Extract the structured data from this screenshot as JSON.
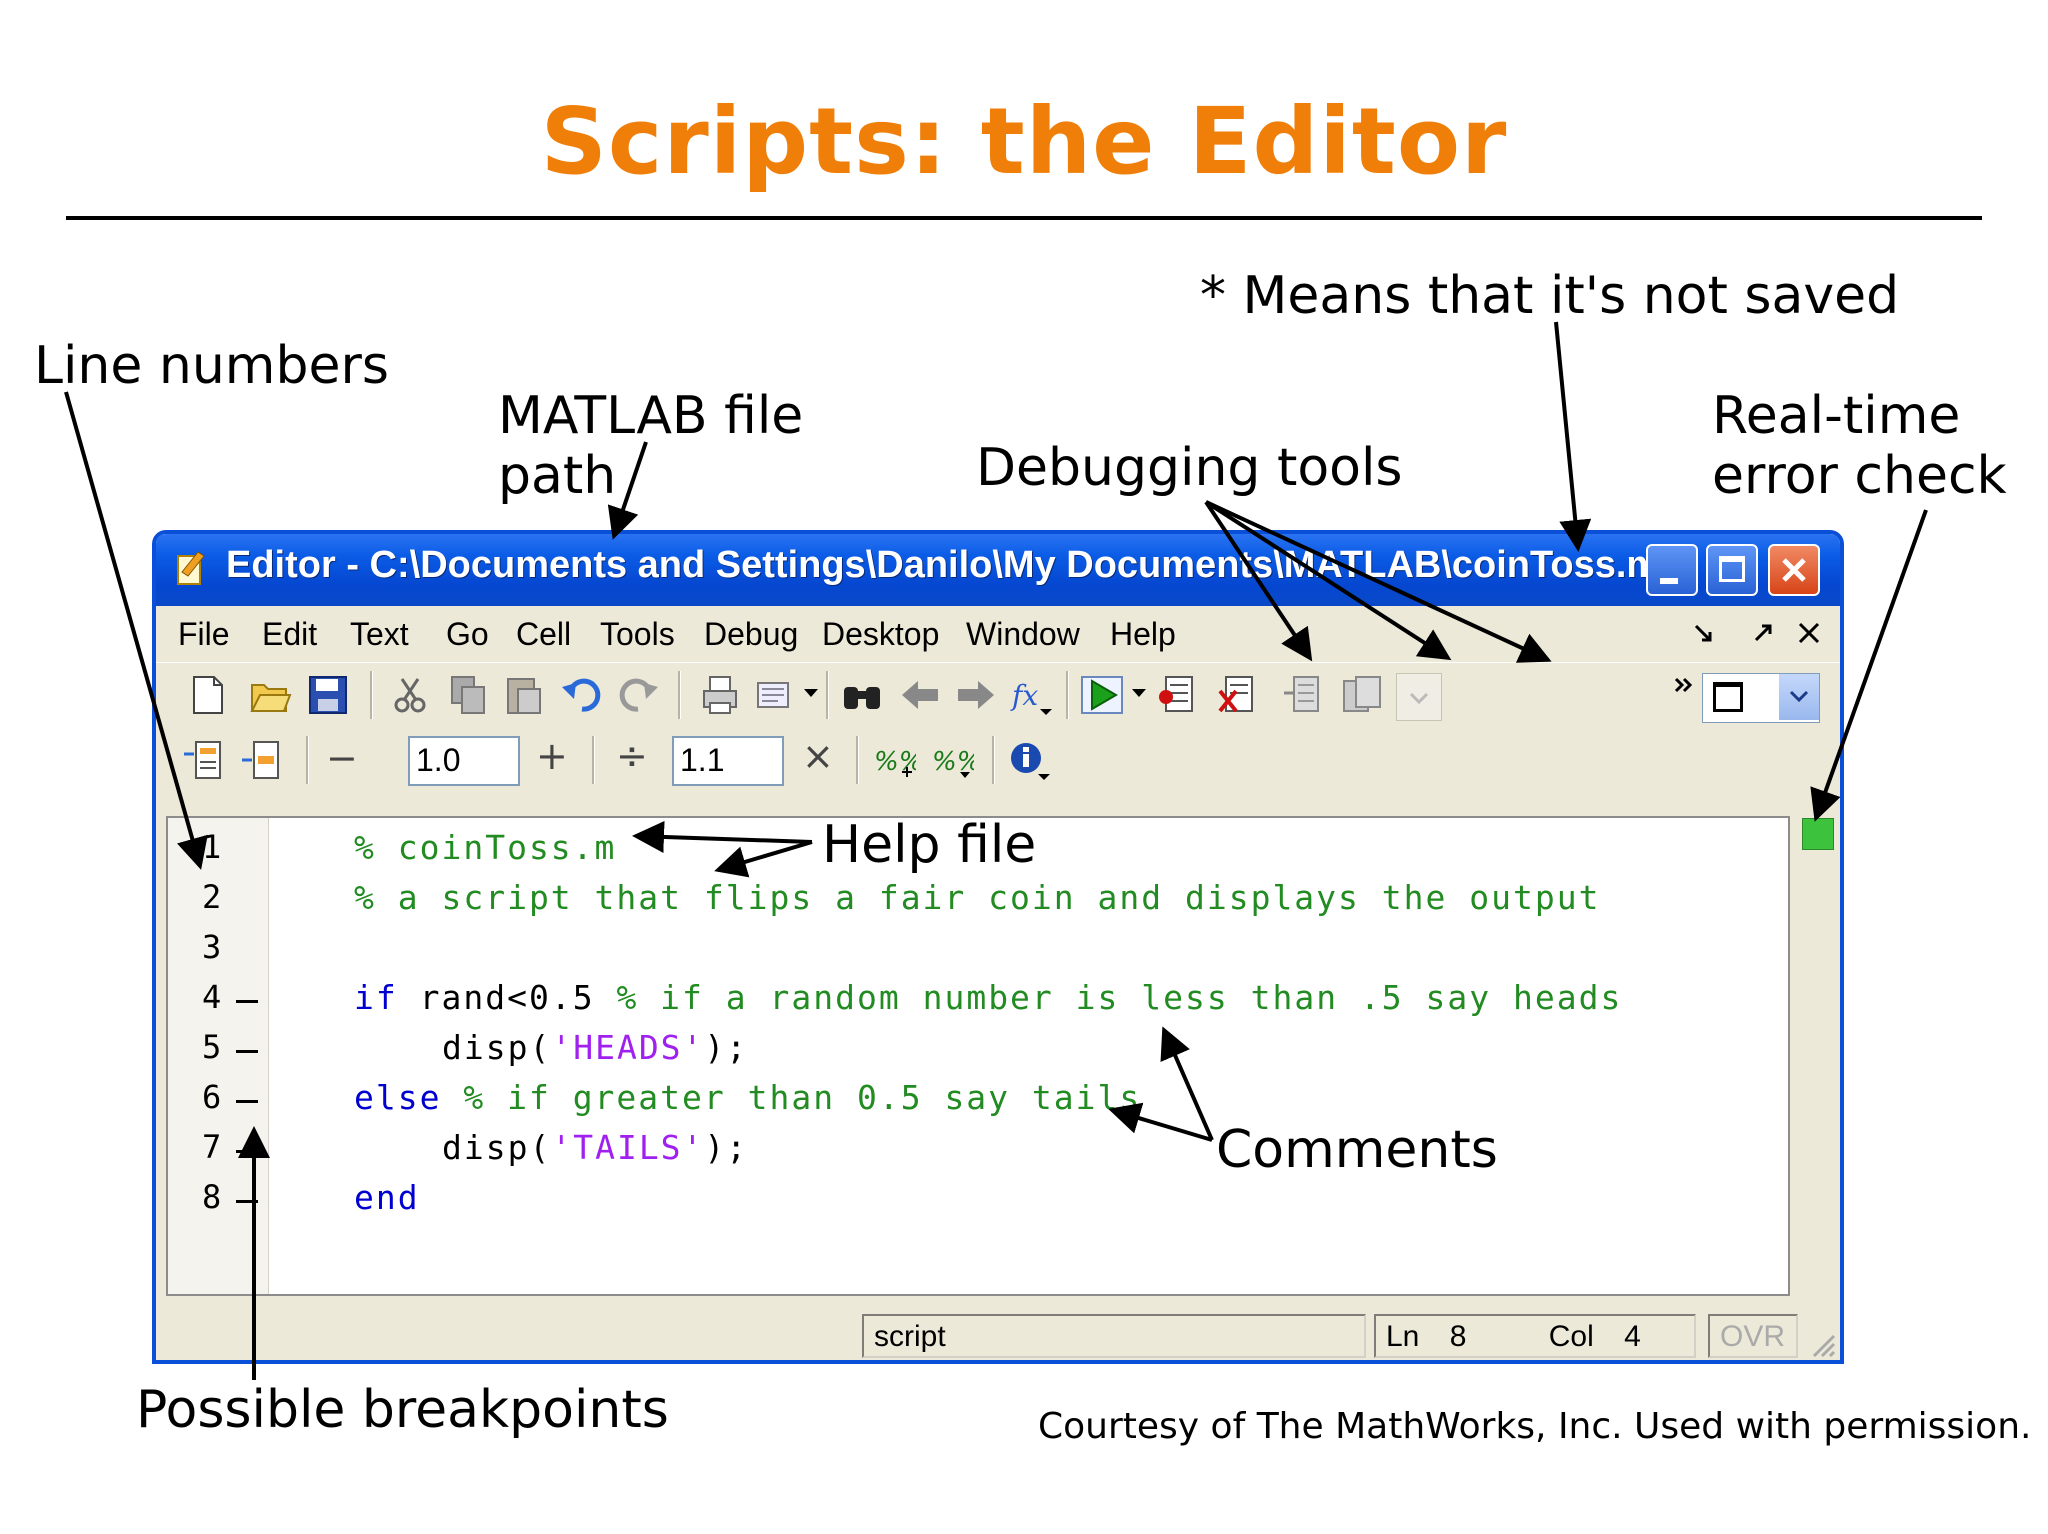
{
  "slide": {
    "title": "Scripts: the Editor",
    "courtesy": "Courtesy of The MathWorks, Inc. Used with permission."
  },
  "annotations": {
    "line_numbers": "Line numbers",
    "file_path_line1": "MATLAB file",
    "file_path_line2": "path",
    "debugging_tools": "Debugging tools",
    "not_saved": "* Means that it's not saved",
    "error_check_line1": "Real-time",
    "error_check_line2": "error check",
    "help_file": "Help file",
    "comments": "Comments",
    "breakpoints": "Possible breakpoints"
  },
  "editor": {
    "title": "Editor - C:\\Documents and Settings\\Danilo\\My Documents\\MATLAB\\coinToss.m*",
    "menu": [
      "File",
      "Edit",
      "Text",
      "Go",
      "Cell",
      "Tools",
      "Debug",
      "Desktop",
      "Window",
      "Help"
    ],
    "cell_toolbar": {
      "minus": "−",
      "value1": "1.0",
      "plus": "+",
      "divide": "÷",
      "value2": "1.1",
      "times": "×"
    },
    "line_numbers": [
      "1",
      "2",
      "3",
      "4",
      "5",
      "6",
      "7",
      "8"
    ],
    "code": {
      "l1_comment": "% coinToss.m",
      "l2_comment": "% a script that flips a fair coin and displays the output",
      "l4_kw": "if",
      "l4_tx": " rand<0.5 ",
      "l4_comment": "% if a random number is less than .5 say heads",
      "l5_tx1": "disp(",
      "l5_str": "'HEADS'",
      "l5_tx2": ");",
      "l6_kw": "else",
      "l6_comment": " % if greater than 0.5 say tails",
      "l7_tx1": "disp(",
      "l7_str": "'TAILS'",
      "l7_tx2": ");",
      "l8_kw": "end"
    },
    "status": {
      "mode": "script",
      "ln_label": "Ln",
      "ln_value": "8",
      "col_label": "Col",
      "col_value": "4",
      "ovr": "OVR"
    },
    "colors": {
      "keyword": "#0000d0",
      "comment": "#228b22",
      "string": "#a020f0",
      "title_accent": "#f07f0a"
    }
  }
}
